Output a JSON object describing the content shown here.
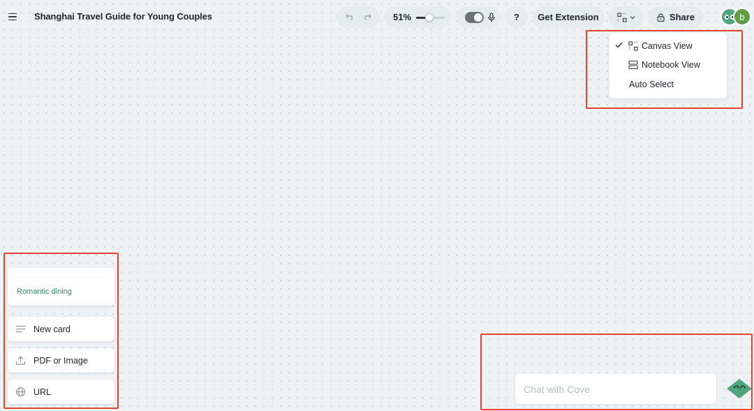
{
  "header": {
    "title": "Shanghai Travel Guide for Young Couples",
    "zoom": "51%",
    "zoom_level_percent": 51,
    "help_label": "?",
    "extension_label": "Get Extension",
    "share_label": "Share",
    "avatar_initial": "b",
    "voice_toggle_on": true
  },
  "view_menu": {
    "items": [
      {
        "label": "Canvas View",
        "checked": true,
        "icon": "canvas-grid-icon"
      },
      {
        "label": "Notebook View",
        "checked": false,
        "icon": "notebook-rows-icon"
      },
      {
        "label": "Auto Select",
        "checked": false,
        "icon": ""
      }
    ]
  },
  "side_panel": {
    "romantic_card": "Romantic dining",
    "new_card": "New card",
    "pdf_image": "PDF or Image",
    "url": "URL"
  },
  "chat": {
    "placeholder": "Chat with Cove"
  },
  "colors": {
    "accent_green": "#2f8a65",
    "annotation_red": "#e8402e",
    "canvas_bg": "#eef2f4"
  }
}
